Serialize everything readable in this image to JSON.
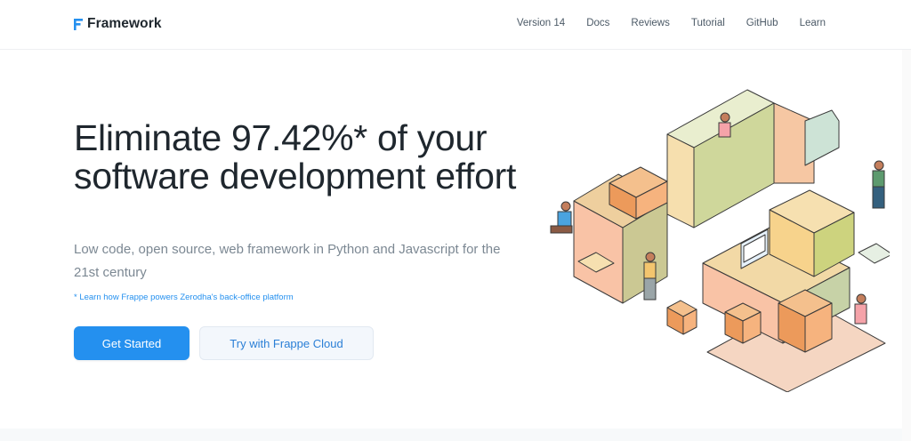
{
  "nav": {
    "brand_name": "Framework",
    "links": [
      "Version 14",
      "Docs",
      "Reviews",
      "Tutorial",
      "GitHub",
      "Learn"
    ]
  },
  "hero": {
    "title": "Eliminate 97.42%* of your software development effort",
    "subtitle": "Low code, open source, web framework in Python and Javascript for the 21st century",
    "note": "* Learn how Frappe powers Zerodha's back-office platform",
    "primary_cta": "Get Started",
    "secondary_cta": "Try with Frappe Cloud"
  },
  "colors": {
    "brand_blue": "#2490ef",
    "text_dark": "#1f272e",
    "text_muted": "#7c8893"
  },
  "icons": {
    "logo": "frappe-f-logo-icon"
  }
}
